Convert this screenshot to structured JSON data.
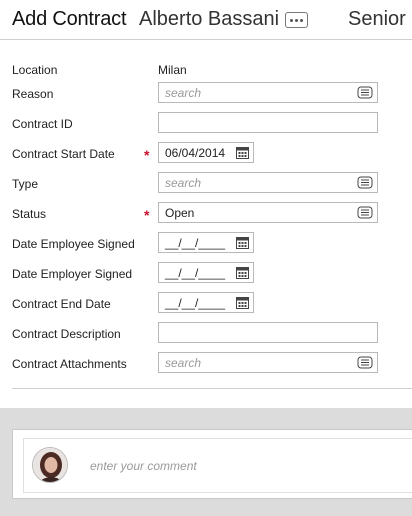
{
  "header": {
    "title": "Add Contract",
    "employee_name": "Alberto Bassani",
    "role": "Senior"
  },
  "form": {
    "location": {
      "label": "Location",
      "value": "Milan"
    },
    "reason": {
      "label": "Reason",
      "placeholder": "search"
    },
    "contract_id": {
      "label": "Contract ID",
      "value": ""
    },
    "contract_start_date": {
      "label": "Contract Start Date",
      "value": "06/04/2014",
      "required_marker": "*"
    },
    "type": {
      "label": "Type",
      "placeholder": "search"
    },
    "status": {
      "label": "Status",
      "value": "Open",
      "required_marker": "*"
    },
    "date_employee_signed": {
      "label": "Date Employee Signed",
      "value": "__/__/____"
    },
    "date_employer_signed": {
      "label": "Date Employer Signed",
      "value": "__/__/____"
    },
    "contract_end_date": {
      "label": "Contract End Date",
      "value": "__/__/____"
    },
    "contract_description": {
      "label": "Contract Description",
      "value": ""
    },
    "contract_attachments": {
      "label": "Contract Attachments",
      "placeholder": "search"
    }
  },
  "comment": {
    "placeholder": "enter your comment"
  },
  "icons": {
    "more": "more-icon",
    "lookup": "lookup-list-icon",
    "calendar": "calendar-icon",
    "avatar": "user-avatar"
  },
  "colors": {
    "required": "#c8102e",
    "placeholder": "#9a9a9a",
    "band": "#dcdcdc"
  }
}
